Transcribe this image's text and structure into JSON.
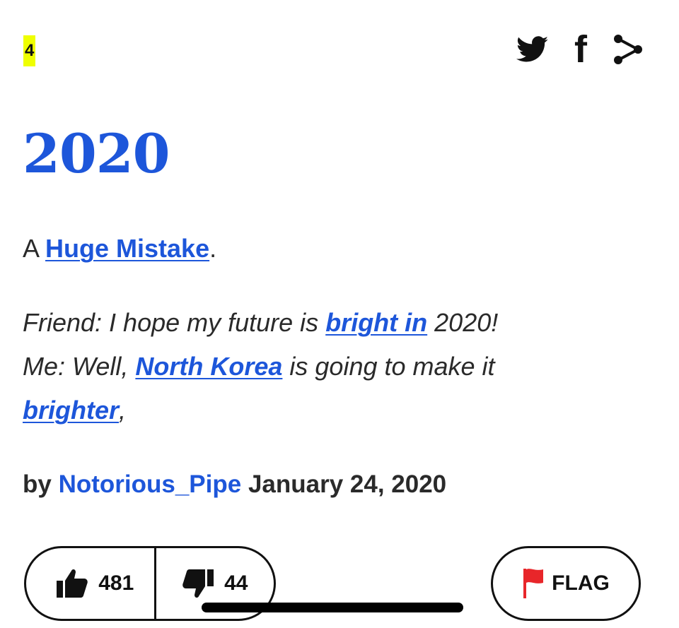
{
  "entry": {
    "rank": "4",
    "word": "2020",
    "meaning": {
      "prefix": "A ",
      "link": "Huge Mistake",
      "suffix": "."
    },
    "example": {
      "line1_pre": "Friend: I hope my future is ",
      "line1_link": "bright in",
      "line1_post": " 2020!",
      "line2_pre": "Me: Well, ",
      "line2_link": "North Korea",
      "line2_post": " is going to make it ",
      "line3_link": "brighter",
      "line3_post": ","
    },
    "byline": {
      "by": "by ",
      "author": "Notorious_Pipe",
      "date": " January 24, 2020"
    }
  },
  "share_icons": [
    "twitter-icon",
    "facebook-icon",
    "share-icon"
  ],
  "facebook_glyph": "f",
  "votes": {
    "up_count": "481",
    "down_count": "44"
  },
  "flag": {
    "label": "FLAG"
  },
  "colors": {
    "accent_blue": "#1d56da",
    "rank_highlight": "#efff00",
    "flag_red": "#e8262a",
    "text": "#2a2a2a"
  }
}
